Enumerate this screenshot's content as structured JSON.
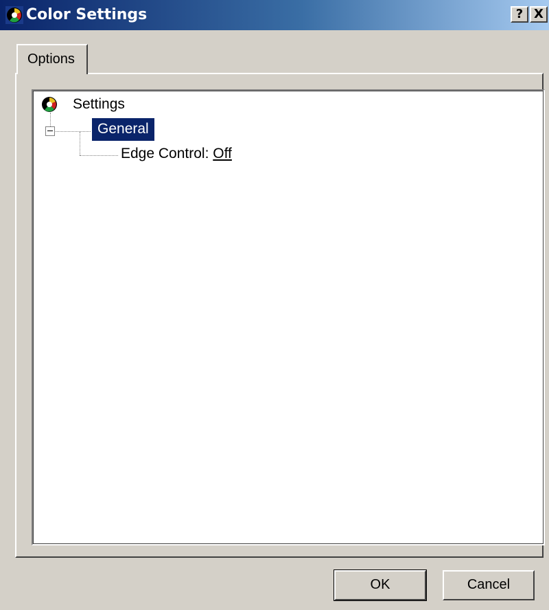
{
  "window": {
    "title": "Color Settings",
    "help_button": "?",
    "close_button": "X"
  },
  "tabs": [
    {
      "label": "Options"
    }
  ],
  "tree": {
    "root": {
      "label": "Settings"
    },
    "general": {
      "label": "General",
      "selected": true,
      "expanded": true
    },
    "edge_control": {
      "label": "Edge Control: ",
      "value": "Off"
    }
  },
  "buttons": {
    "ok_label": "OK",
    "cancel_label": "Cancel"
  },
  "colors": {
    "title_bar": "#0a246a",
    "selection": "#0a246a",
    "face": "#d4d0c8"
  }
}
